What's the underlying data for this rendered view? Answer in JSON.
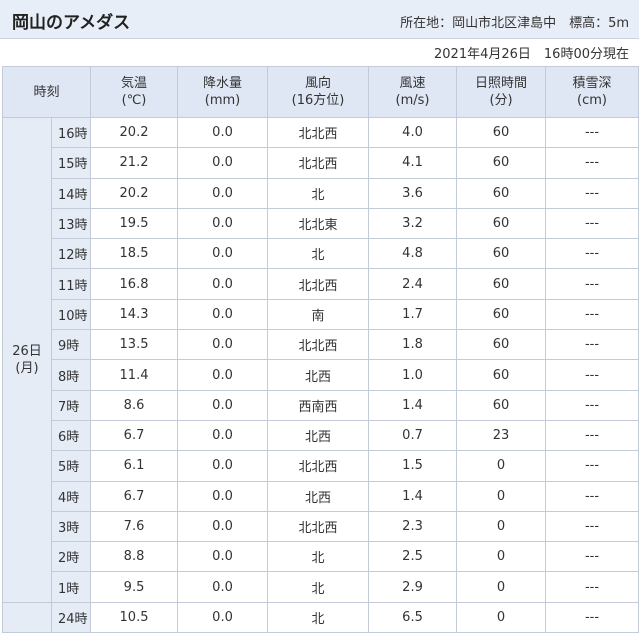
{
  "header": {
    "title": "岡山のアメダス",
    "location": "所在地：岡山市北区津島中　標高：5m",
    "date": "2021年4月26日　16時00分現在"
  },
  "table": {
    "columns": [
      {
        "line1": "時刻",
        "line2": ""
      },
      {
        "line1": "気温",
        "line2": "(℃)"
      },
      {
        "line1": "降水量",
        "line2": "(mm)"
      },
      {
        "line1": "風向",
        "line2": "(16方位)"
      },
      {
        "line1": "風速",
        "line2": "(m/s)"
      },
      {
        "line1": "日照時間",
        "line2": "(分)"
      },
      {
        "line1": "積雪深",
        "line2": "(cm)"
      }
    ],
    "days": [
      {
        "day": "26日",
        "weekday": "(月)"
      },
      {
        "day": "",
        "weekday": ""
      }
    ],
    "rows": [
      {
        "hour": "16時",
        "temp": "20.2",
        "precip": "0.0",
        "wind_dir": "北北西",
        "wind_speed": "4.0",
        "sunshine": "60",
        "snow": "---"
      },
      {
        "hour": "15時",
        "temp": "21.2",
        "precip": "0.0",
        "wind_dir": "北北西",
        "wind_speed": "4.1",
        "sunshine": "60",
        "snow": "---"
      },
      {
        "hour": "14時",
        "temp": "20.2",
        "precip": "0.0",
        "wind_dir": "北",
        "wind_speed": "3.6",
        "sunshine": "60",
        "snow": "---"
      },
      {
        "hour": "13時",
        "temp": "19.5",
        "precip": "0.0",
        "wind_dir": "北北東",
        "wind_speed": "3.2",
        "sunshine": "60",
        "snow": "---"
      },
      {
        "hour": "12時",
        "temp": "18.5",
        "precip": "0.0",
        "wind_dir": "北",
        "wind_speed": "4.8",
        "sunshine": "60",
        "snow": "---"
      },
      {
        "hour": "11時",
        "temp": "16.8",
        "precip": "0.0",
        "wind_dir": "北北西",
        "wind_speed": "2.4",
        "sunshine": "60",
        "snow": "---"
      },
      {
        "hour": "10時",
        "temp": "14.3",
        "precip": "0.0",
        "wind_dir": "南",
        "wind_speed": "1.7",
        "sunshine": "60",
        "snow": "---"
      },
      {
        "hour": "9時",
        "temp": "13.5",
        "precip": "0.0",
        "wind_dir": "北北西",
        "wind_speed": "1.8",
        "sunshine": "60",
        "snow": "---"
      },
      {
        "hour": "8時",
        "temp": "11.4",
        "precip": "0.0",
        "wind_dir": "北西",
        "wind_speed": "1.0",
        "sunshine": "60",
        "snow": "---"
      },
      {
        "hour": "7時",
        "temp": "8.6",
        "precip": "0.0",
        "wind_dir": "西南西",
        "wind_speed": "1.4",
        "sunshine": "60",
        "snow": "---"
      },
      {
        "hour": "6時",
        "temp": "6.7",
        "precip": "0.0",
        "wind_dir": "北西",
        "wind_speed": "0.7",
        "sunshine": "23",
        "snow": "---"
      },
      {
        "hour": "5時",
        "temp": "6.1",
        "precip": "0.0",
        "wind_dir": "北北西",
        "wind_speed": "1.5",
        "sunshine": "0",
        "snow": "---"
      },
      {
        "hour": "4時",
        "temp": "6.7",
        "precip": "0.0",
        "wind_dir": "北西",
        "wind_speed": "1.4",
        "sunshine": "0",
        "snow": "---"
      },
      {
        "hour": "3時",
        "temp": "7.6",
        "precip": "0.0",
        "wind_dir": "北北西",
        "wind_speed": "2.3",
        "sunshine": "0",
        "snow": "---"
      },
      {
        "hour": "2時",
        "temp": "8.8",
        "precip": "0.0",
        "wind_dir": "北",
        "wind_speed": "2.5",
        "sunshine": "0",
        "snow": "---"
      },
      {
        "hour": "1時",
        "temp": "9.5",
        "precip": "0.0",
        "wind_dir": "北",
        "wind_speed": "2.9",
        "sunshine": "0",
        "snow": "---"
      },
      {
        "hour": "24時",
        "temp": "10.5",
        "precip": "0.0",
        "wind_dir": "北",
        "wind_speed": "6.5",
        "sunshine": "0",
        "snow": "---"
      }
    ]
  }
}
